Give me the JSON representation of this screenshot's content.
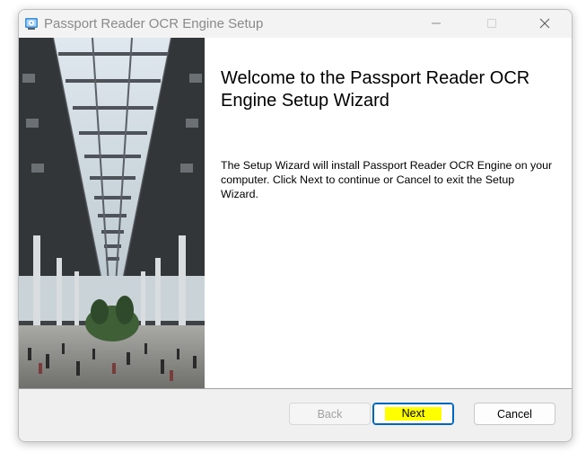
{
  "window": {
    "title": "Passport Reader OCR Engine Setup"
  },
  "welcome": {
    "heading": "Welcome to the Passport Reader OCR Engine Setup Wizard",
    "body": "The Setup Wizard will install Passport Reader OCR Engine on your computer. Click Next to continue or Cancel to exit the Setup Wizard."
  },
  "buttons": {
    "back": "Back",
    "next": "Next",
    "cancel": "Cancel"
  },
  "colors": {
    "accent": "#0067c0",
    "highlight": "#ffff00"
  },
  "icons": {
    "app": "installer-disc-icon",
    "minimize": "minimize-icon",
    "maximize": "maximize-icon",
    "close": "close-icon"
  }
}
